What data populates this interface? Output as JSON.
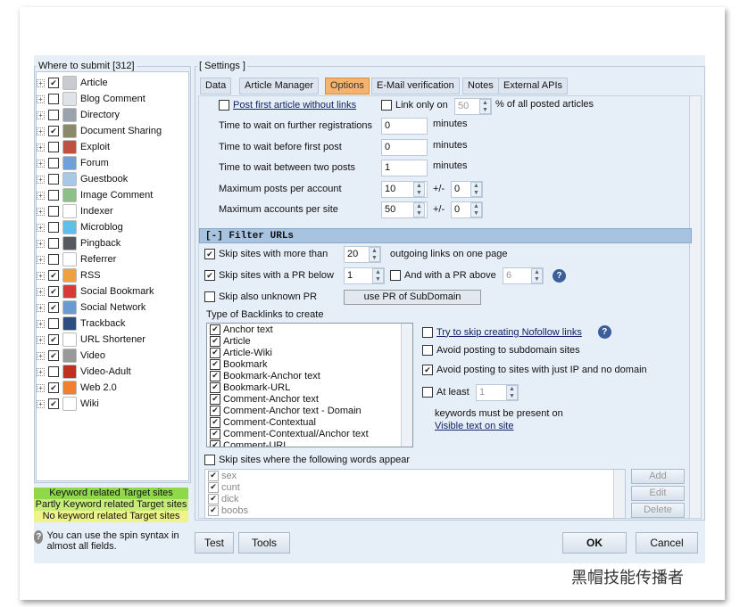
{
  "left": {
    "title": "Where to submit [312]",
    "items": [
      {
        "label": "Article",
        "checked": true,
        "icon": "article-icon",
        "color": "#c8cbd0"
      },
      {
        "label": "Blog Comment",
        "checked": false,
        "icon": "blog-comment-icon",
        "color": "#dfe3e8"
      },
      {
        "label": "Directory",
        "checked": false,
        "icon": "directory-icon",
        "color": "#9aa3ad"
      },
      {
        "label": "Document Sharing",
        "checked": true,
        "icon": "document-sharing-icon",
        "color": "#8a8a6a"
      },
      {
        "label": "Exploit",
        "checked": false,
        "icon": "exploit-icon",
        "color": "#c05040"
      },
      {
        "label": "Forum",
        "checked": false,
        "icon": "forum-icon",
        "color": "#6fa0d8"
      },
      {
        "label": "Guestbook",
        "checked": false,
        "icon": "guestbook-icon",
        "color": "#a8c8e8"
      },
      {
        "label": "Image Comment",
        "checked": false,
        "icon": "image-comment-icon",
        "color": "#8cc088"
      },
      {
        "label": "Indexer",
        "checked": false,
        "icon": "indexer-icon",
        "color": "#ffffff"
      },
      {
        "label": "Microblog",
        "checked": false,
        "icon": "microblog-icon",
        "color": "#5cc0e8"
      },
      {
        "label": "Pingback",
        "checked": false,
        "icon": "pingback-icon",
        "color": "#555a60"
      },
      {
        "label": "Referrer",
        "checked": false,
        "icon": "referrer-icon",
        "color": "#ffffff"
      },
      {
        "label": "RSS",
        "checked": true,
        "icon": "rss-icon",
        "color": "#f0a040"
      },
      {
        "label": "Social Bookmark",
        "checked": true,
        "icon": "social-bookmark-icon",
        "color": "#d83a3a"
      },
      {
        "label": "Social Network",
        "checked": true,
        "icon": "social-network-icon",
        "color": "#6a9ad0"
      },
      {
        "label": "Trackback",
        "checked": false,
        "icon": "trackback-icon",
        "color": "#2c4f80"
      },
      {
        "label": "URL Shortener",
        "checked": true,
        "icon": "url-shortener-icon",
        "color": "#ffffff"
      },
      {
        "label": "Video",
        "checked": true,
        "icon": "video-icon",
        "color": "#999999"
      },
      {
        "label": "Video-Adult",
        "checked": false,
        "icon": "video-adult-icon",
        "color": "#c03020"
      },
      {
        "label": "Web 2.0",
        "checked": true,
        "icon": "web20-icon",
        "color": "#f08030"
      },
      {
        "label": "Wiki",
        "checked": true,
        "icon": "wiki-icon",
        "color": "#ffffff"
      }
    ],
    "legend": [
      {
        "label": "Keyword related Target sites",
        "color": "#8fd84a"
      },
      {
        "label": "Partly Keyword related Target sites",
        "color": "#c8ec7a"
      },
      {
        "label": "No keyword related Target sites",
        "color": "#eef48a"
      }
    ],
    "hint": "You can use the spin syntax in almost all fields."
  },
  "settings": {
    "title": "[ Settings ]",
    "tabs": [
      {
        "label": "Data"
      },
      {
        "label": "Article Manager"
      },
      {
        "label": "Options",
        "active": true
      },
      {
        "label": "E-Mail verification"
      },
      {
        "label": "Notes"
      },
      {
        "label": "External APIs"
      }
    ],
    "post_first": "Post first article without links",
    "link_only": "Link only on",
    "link_only_value": "50",
    "link_only_suffix": "% of all posted articles",
    "rows": [
      {
        "label": "Time to wait on further registrations",
        "value": "0",
        "unit": "minutes"
      },
      {
        "label": "Time to wait before first post",
        "value": "0",
        "unit": "minutes"
      },
      {
        "label": "Time to wait between two posts",
        "value": "1",
        "unit": "minutes"
      }
    ],
    "max_posts": {
      "label": "Maximum posts per account",
      "value": "10",
      "pm": "+/-",
      "pm_value": "0"
    },
    "max_accounts": {
      "label": "Maximum accounts per site",
      "value": "50",
      "pm": "+/-",
      "pm_value": "0"
    },
    "filter_header": "[-] Filter URLs",
    "skip_outgoing": {
      "label": "Skip sites with more than",
      "value": "20",
      "suffix": "outgoing links on one page"
    },
    "skip_pr": {
      "label": "Skip sites with a PR below",
      "value": "1",
      "and_label": "And with a PR above",
      "and_value": "6"
    },
    "skip_unknown": "Skip also unknown PR",
    "use_pr_sub": "use PR of SubDomain",
    "backlinks_title": "Type of Backlinks to create",
    "backlinks": [
      "Anchor text",
      "Article",
      "Article-Wiki",
      "Bookmark",
      "Bookmark-Anchor text",
      "Bookmark-URL",
      "Comment-Anchor text",
      "Comment-Anchor text - Domain",
      "Comment-Contextual",
      "Comment-Contextual/Anchor text",
      "Comment-URL"
    ],
    "nofollow": "Try to skip creating Nofollow links",
    "avoid_sub": "Avoid posting to subdomain sites",
    "avoid_ip": "Avoid posting to sites with just IP and no domain",
    "at_least": "At least",
    "at_least_value": "1",
    "keywords_present": "keywords must be present on",
    "visible_text": "Visible text on site",
    "skip_words": "Skip sites where the following words appear",
    "words": [
      "sex",
      "cunt",
      "dick",
      "boobs"
    ],
    "add": "Add",
    "edit": "Edit",
    "delete": "Delete"
  },
  "footer": {
    "test": "Test",
    "tools": "Tools",
    "ok": "OK",
    "cancel": "Cancel"
  },
  "watermark": "黑帽技能传播者"
}
